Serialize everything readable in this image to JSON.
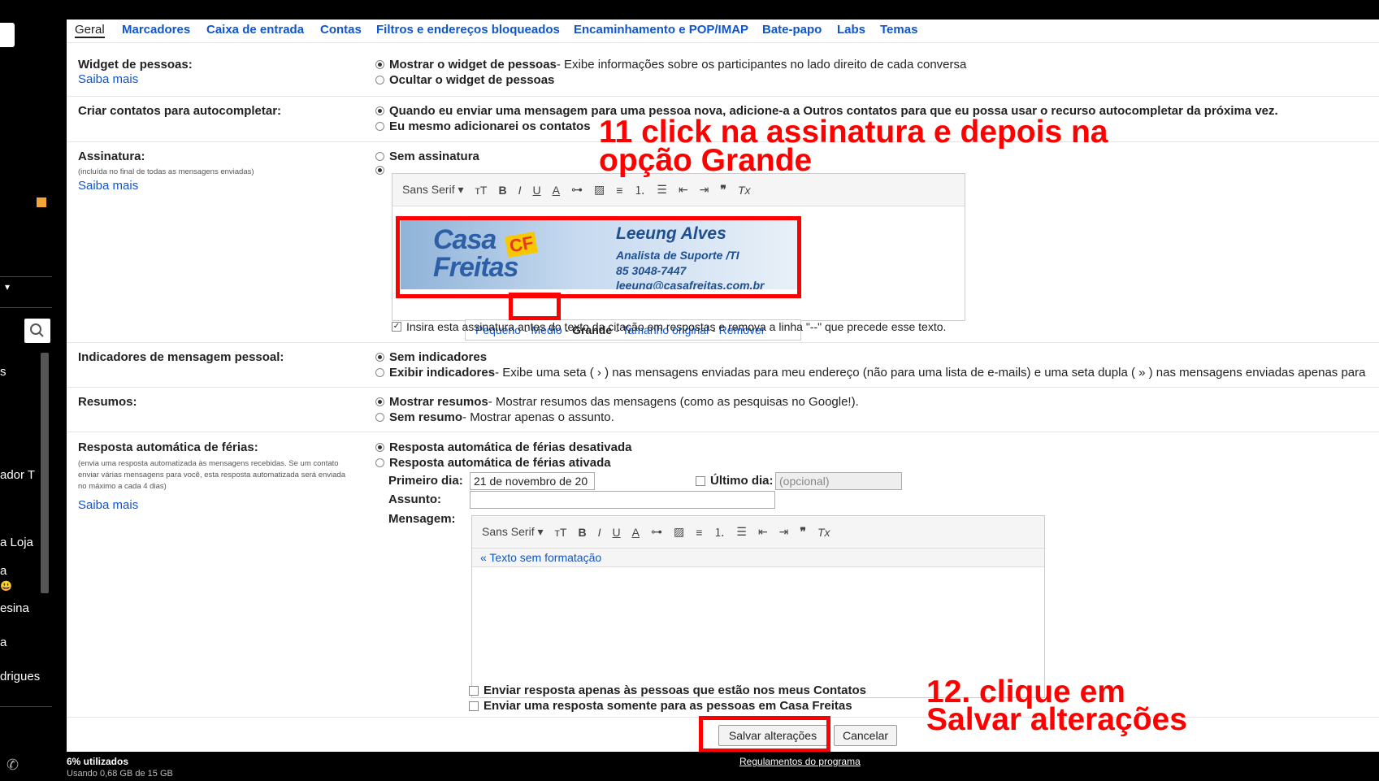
{
  "tabs": [
    "Geral",
    "Marcadores",
    "Caixa de entrada",
    "Contas",
    "Filtros e endereços bloqueados",
    "Encaminhamento e POP/IMAP",
    "Bate-papo",
    "Labs",
    "Temas"
  ],
  "sidebar": {
    "items": [
      "s",
      "ador T",
      "a Loja",
      "a",
      "esina",
      "a",
      "drigues"
    ]
  },
  "people_widget": {
    "label": "Widget de pessoas:",
    "learn_more": "Saiba mais",
    "opt1_bold": "Mostrar o widget de pessoas",
    "opt1_rest": " - Exibe informações sobre os participantes no lado direito de cada conversa",
    "opt2": "Ocultar o widget de pessoas"
  },
  "autocomplete": {
    "label": "Criar contatos para autocompletar:",
    "opt1": "Quando eu enviar uma mensagem para uma pessoa nova, adicione-a a Outros contatos para que eu possa usar o recurso autocompletar da próxima vez.",
    "opt2": "Eu mesmo adicionarei os contatos"
  },
  "signature": {
    "label": "Assinatura:",
    "note": "(incluída no final de todas as mensagens enviadas)",
    "learn_more": "Saiba mais",
    "opt_none": "Sem assinatura",
    "card_name": "Leeung Alves",
    "card_title": "Analista de Suporte /TI",
    "card_phone": "85 3048-7447",
    "card_email": "leeung@casafreitas.com.br",
    "logo1": "Casa",
    "logo2": "Freitas",
    "logo_cf": "CF",
    "size_small": "Pequeno",
    "size_medium": "Médio",
    "size_large": "Grande",
    "size_original": "Tamanho original",
    "size_remove": "Remover",
    "insert_before": "Insira esta assinatura antes do texto da citação em respostas e remova a linha \"--\" que precede esse texto."
  },
  "toolbar": {
    "font": "Sans Serif",
    "font_caret": "▾",
    "size": "тT",
    "bold": "B",
    "italic": "I",
    "underline": "U",
    "color": "A",
    "link": "⊶",
    "image": "▨",
    "align": "≡",
    "olist": "⒈",
    "ulist": "☰",
    "indent_less": "⇤",
    "indent_more": "⇥",
    "quote": "❞",
    "clear": "Tx"
  },
  "personal_indicators": {
    "label": "Indicadores de mensagem pessoal:",
    "opt1": "Sem indicadores",
    "opt2_bold": "Exibir indicadores",
    "opt2_rest": " - Exibe uma seta ( › ) nas mensagens enviadas para meu endereço (não para uma lista de e-mails) e uma seta dupla ( » ) nas mensagens enviadas apenas para"
  },
  "snippets": {
    "label": "Resumos:",
    "opt1_bold": "Mostrar resumos",
    "opt1_rest": " - Mostrar resumos das mensagens (como as pesquisas no Google!).",
    "opt2_bold": "Sem resumo",
    "opt2_rest": " - Mostrar apenas o assunto."
  },
  "vacation": {
    "label": "Resposta automática de férias:",
    "note": "(envia uma resposta automatizada às mensagens recebidas. Se um contato enviar várias mensagens para você, esta resposta automatizada será enviada no máximo a cada 4 dias)",
    "learn_more": "Saiba mais",
    "opt_off": "Resposta automática de férias desativada",
    "opt_on": "Resposta automática de férias ativada",
    "first_day_label": "Primeiro dia:",
    "first_day_value": "21 de novembro de 20",
    "last_day_label": "Último dia:",
    "last_day_placeholder": "(opcional)",
    "subject_label": "Assunto:",
    "message_label": "Mensagem:",
    "plain_text_link": "« Texto sem formatação",
    "only_contacts": "Enviar resposta apenas às pessoas que estão nos meus Contatos",
    "only_domain": "Enviar uma resposta somente para as pessoas em Casa Freitas"
  },
  "buttons": {
    "save": "Salvar alterações",
    "cancel": "Cancelar"
  },
  "footer": {
    "usage": "6% utilizados",
    "usage_sub": "Usando 0,68 GB de 15 GB",
    "program_link": "Regulamentos do programa"
  },
  "annotations": {
    "step11_line1": "11 click na assinatura e depois na",
    "step11_line2": "opção Grande",
    "step12_line1": "12. clique em",
    "step12_line2": "Salvar alterações"
  }
}
